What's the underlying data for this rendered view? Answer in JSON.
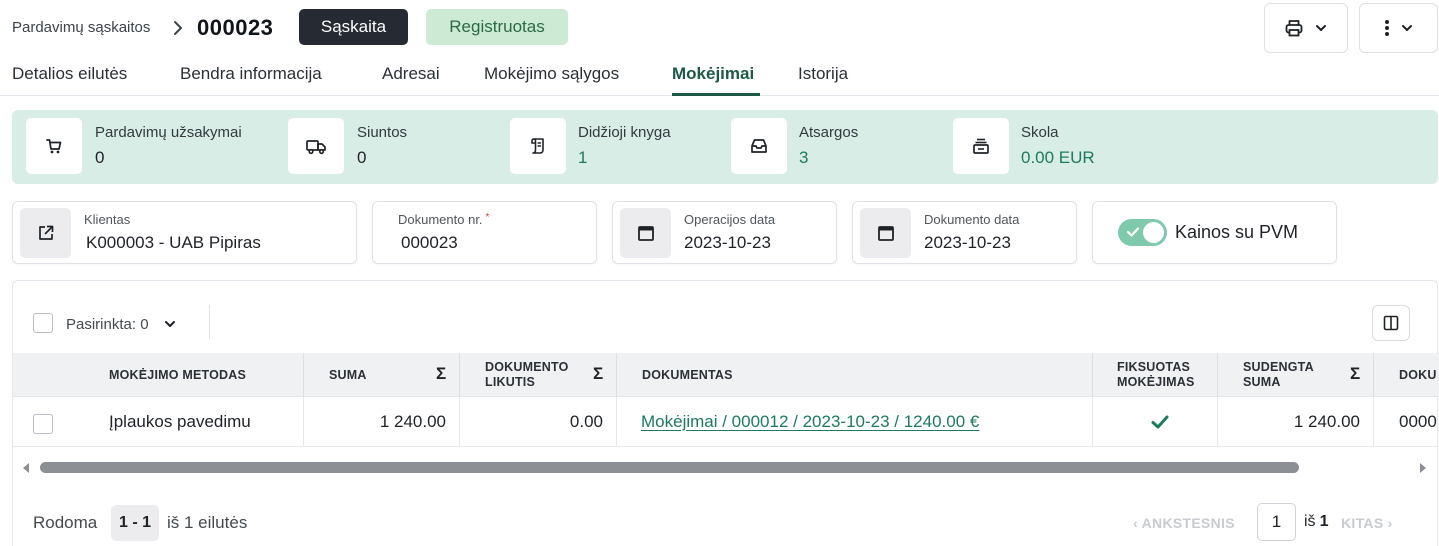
{
  "header": {
    "breadcrumb_parent": "Pardavimų sąskaitos",
    "document_number": "000023",
    "type_badge": "Sąskaita",
    "status_badge": "Registruotas"
  },
  "tabs": [
    {
      "label": "Detalios eilutės",
      "active": false
    },
    {
      "label": "Bendra informacija",
      "active": false
    },
    {
      "label": "Adresai",
      "active": false
    },
    {
      "label": "Mokėjimo sąlygos",
      "active": false
    },
    {
      "label": "Mokėjimai",
      "active": true
    },
    {
      "label": "Istorija",
      "active": false
    }
  ],
  "stats": [
    {
      "label": "Pardavimų užsakymai",
      "value": "0",
      "icon": "cart-icon"
    },
    {
      "label": "Siuntos",
      "value": "0",
      "icon": "truck-icon"
    },
    {
      "label": "Didžioji knyga",
      "value": "1",
      "icon": "ledger-icon"
    },
    {
      "label": "Atsargos",
      "value": "3",
      "icon": "inventory-icon"
    },
    {
      "label": "Skola",
      "value": "0.00 EUR",
      "icon": "debt-icon"
    }
  ],
  "form": {
    "client": {
      "label": "Klientas",
      "value": "K000003 - UAB Pipiras"
    },
    "document_no": {
      "label": "Dokumento nr.",
      "required_mark": "*",
      "value": "000023"
    },
    "operation_date": {
      "label": "Operacijos data",
      "value": "2023-10-23"
    },
    "document_date": {
      "label": "Dokumento data",
      "value": "2023-10-23"
    },
    "prices_with_vat": {
      "label": "Kainos su PVM",
      "checked": true
    }
  },
  "grid": {
    "selected_text": "Pasirinkta: 0",
    "sum_symbol": "Σ",
    "columns": [
      "MOKĖJIMO METODAS",
      "SUMA",
      "DOKUMENTO LIKUTIS",
      "DOKUMENTAS",
      "FIKSUOTAS MOKĖJIMAS",
      "SUDENGTA SUMA",
      "DOKU"
    ],
    "rows": [
      {
        "method": "Įplaukos pavedimu",
        "amount": "1 240.00",
        "balance": "0.00",
        "document": "Mokėjimai / 000012 / 2023-10-23 / 1240.00 €",
        "fixed": true,
        "settled": "1 240.00",
        "doc_partial": "0000"
      }
    ]
  },
  "pagination": {
    "showing_label": "Rodoma",
    "range": "1 - 1",
    "of_rows": "iš 1 eilutės",
    "prev_label": "ANKSTESNIS",
    "current_page": "1",
    "of_label": "iš",
    "total_pages": "1",
    "next_label": "KITAS"
  },
  "colors": {
    "accent": "#1d5a46",
    "link": "#1e7a5e",
    "stats_bg": "#d8ede6",
    "status_bg": "#cdebd4",
    "dark_badge": "#262b33"
  }
}
